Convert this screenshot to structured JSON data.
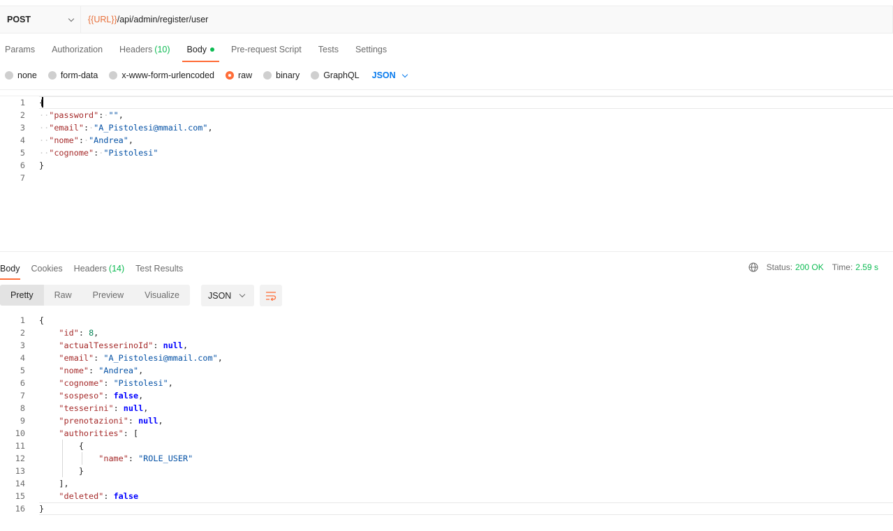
{
  "request": {
    "method": "POST",
    "url_var": "{{URL}}",
    "url_path": "/api/admin/register/user"
  },
  "req_tabs": {
    "params": "Params",
    "authorization": "Authorization",
    "headers": "Headers",
    "headers_count": "(10)",
    "body": "Body",
    "prerequest": "Pre-request Script",
    "tests": "Tests",
    "settings": "Settings"
  },
  "body_types": {
    "none": "none",
    "form_data": "form-data",
    "urlencoded": "x-www-form-urlencoded",
    "raw": "raw",
    "binary": "binary",
    "graphql": "GraphQL",
    "format": "JSON",
    "selected": "raw"
  },
  "request_body": {
    "line_numbers": [
      "1",
      "2",
      "3",
      "4",
      "5",
      "6",
      "7"
    ],
    "brace_open": "{",
    "brace_close": "}",
    "k_password": "\"password\"",
    "v_password": "\"\"",
    "k_email": "\"email\"",
    "v_email": "\"A_Pistolesi@mmail.com\"",
    "k_nome": "\"nome\"",
    "v_nome": "\"Andrea\"",
    "k_cognome": "\"cognome\"",
    "v_cognome": "\"Pistolesi\""
  },
  "resp_tabs": {
    "body": "Body",
    "cookies": "Cookies",
    "headers": "Headers",
    "headers_count": "(14)",
    "test_results": "Test Results"
  },
  "status": {
    "status_label": "Status:",
    "status_value": "200 OK",
    "time_label": "Time:",
    "time_value": "2.59 s"
  },
  "view_modes": {
    "pretty": "Pretty",
    "raw": "Raw",
    "preview": "Preview",
    "visualize": "Visualize",
    "format": "JSON"
  },
  "response_body": {
    "line_numbers": [
      "1",
      "2",
      "3",
      "4",
      "5",
      "6",
      "7",
      "8",
      "9",
      "10",
      "11",
      "12",
      "13",
      "14",
      "15",
      "16"
    ],
    "brace_open": "{",
    "brace_close": "}",
    "k_id": "\"id\"",
    "v_id": "8",
    "k_tess": "\"actualTesserinoId\"",
    "v_null": "null",
    "k_email": "\"email\"",
    "v_email": "\"A_Pistolesi@mmail.com\"",
    "k_nome": "\"nome\"",
    "v_nome": "\"Andrea\"",
    "k_cognome": "\"cognome\"",
    "v_cognome": "\"Pistolesi\"",
    "k_sospeso": "\"sospeso\"",
    "v_false": "false",
    "k_tesserini": "\"tesserini\"",
    "k_prenotazioni": "\"prenotazioni\"",
    "k_authorities": "\"authorities\"",
    "bracket_open": "[",
    "bracket_close": "],",
    "k_name": "\"name\"",
    "v_role": "\"ROLE_USER\"",
    "k_deleted": "\"deleted\""
  },
  "colors": {
    "accent": "#ff6c37",
    "status_green": "#0cbb52",
    "link_blue": "#097bed"
  }
}
